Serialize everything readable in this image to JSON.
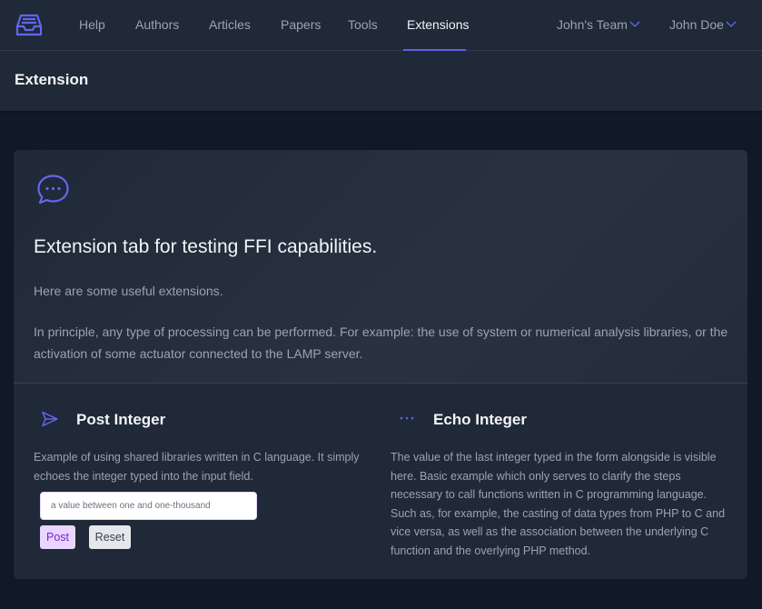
{
  "nav": {
    "links": [
      "Help",
      "Authors",
      "Articles",
      "Papers",
      "Tools",
      "Extensions"
    ],
    "active": "Extensions",
    "team_label": "John's Team",
    "user_label": "John Doe"
  },
  "page": {
    "title": "Extension"
  },
  "card": {
    "headline": "Extension tab for testing FFI capabilities.",
    "intro": "Here are some useful extensions.",
    "description": "In principle, any type of processing can be performed. For example: the use of system or numerical analysis libraries, or the activation of some actuator connected to the LAMP server."
  },
  "post": {
    "title": "Post Integer",
    "text": "Example of using shared libraries written in C language. It simply echoes the integer typed into the input field.",
    "placeholder": "a value between one and one-thousand",
    "post_label": "Post",
    "reset_label": "Reset"
  },
  "echo": {
    "title": "Echo Integer",
    "text": "The value of the last integer typed in the form alongside is visible here. Basic example which only serves to clarify the steps necessary to call functions written in C programming language. Such as, for example, the casting of data types from PHP to C and vice versa, as well as the association between the underlying C function and the overlying PHP method."
  },
  "colors": {
    "accent": "#6366f1",
    "background": "#111827",
    "panel": "#1f2937"
  },
  "icons": [
    "inbox-logo-icon",
    "chevron-down-icon",
    "chat-bubble-icon",
    "paper-airplane-icon",
    "ellipsis-icon"
  ]
}
